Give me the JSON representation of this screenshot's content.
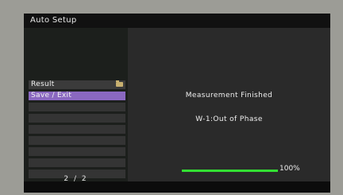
{
  "header": {
    "title": "Auto Setup"
  },
  "menu": {
    "items": [
      {
        "label": "Result",
        "icon": "folder-icon",
        "selected": false
      },
      {
        "label": "Save / Exit",
        "selected": true
      },
      {
        "label": ""
      },
      {
        "label": ""
      },
      {
        "label": ""
      },
      {
        "label": ""
      },
      {
        "label": ""
      },
      {
        "label": ""
      },
      {
        "label": ""
      }
    ],
    "page": "2 / 2"
  },
  "status": {
    "message": "Measurement Finished",
    "warning": "W-1:Out of Phase"
  },
  "progress": {
    "value": 100,
    "label": "100%"
  },
  "colors": {
    "selected": "#8a68c0",
    "progress": "#33e033",
    "background": "#262626"
  }
}
